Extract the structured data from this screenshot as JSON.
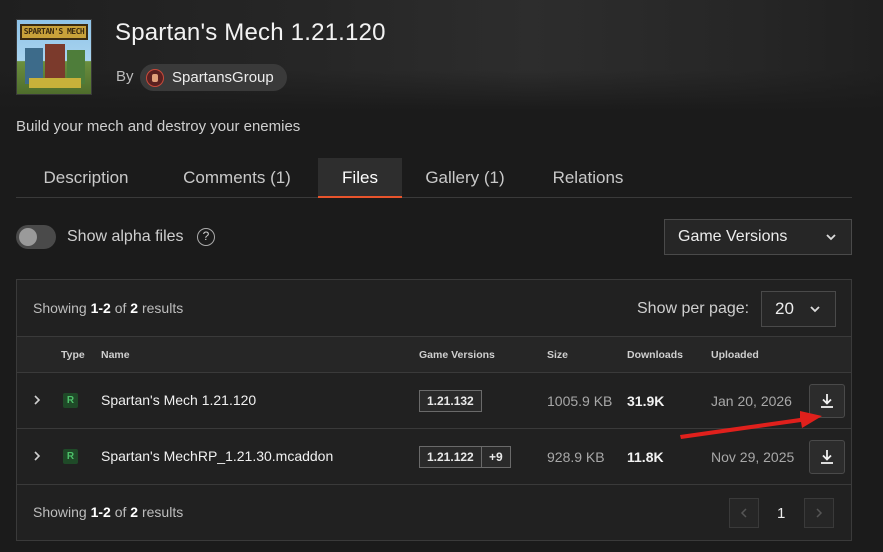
{
  "project": {
    "title": "Spartan's Mech 1.21.120",
    "by_label": "By",
    "author": "SpartansGroup",
    "summary": "Build your mech and destroy your enemies",
    "thumbnail_text": "SPARTAN'S MECH"
  },
  "tabs": [
    {
      "label": "Description"
    },
    {
      "label": "Comments (1)"
    },
    {
      "label": "Files",
      "active": true
    },
    {
      "label": "Gallery (1)"
    },
    {
      "label": "Relations"
    }
  ],
  "filters": {
    "alpha_label": "Show alpha files",
    "alpha_enabled": false,
    "help_glyph": "?",
    "game_versions_label": "Game Versions"
  },
  "results": {
    "showing_prefix": "Showing",
    "range": "1-2",
    "of": "of",
    "total": "2",
    "suffix": "results",
    "per_page_label": "Show per page:",
    "per_page_value": "20"
  },
  "table": {
    "headers": {
      "type": "Type",
      "name": "Name",
      "game_versions": "Game Versions",
      "size": "Size",
      "downloads": "Downloads",
      "uploaded": "Uploaded"
    },
    "rows": [
      {
        "type": "R",
        "name": "Spartan's Mech 1.21.120",
        "versions": [
          "1.21.132"
        ],
        "size": "1005.9 KB",
        "downloads": "31.9K",
        "uploaded": "Jan 20, 2026"
      },
      {
        "type": "R",
        "name": "Spartan's MechRP_1.21.30.mcaddon",
        "versions": [
          "1.21.122",
          "+9"
        ],
        "size": "928.9 KB",
        "downloads": "11.8K",
        "uploaded": "Nov 29, 2025"
      }
    ]
  },
  "pagination": {
    "current": "1"
  },
  "colors": {
    "accent": "#e8542c",
    "release_badge": "#4ec06a",
    "annotation_arrow": "#e0201c"
  },
  "icons": {
    "expand": "chevron-right-icon",
    "download": "download-icon",
    "dropdown": "chevron-down-icon",
    "annotation": "red-arrow-annotation"
  }
}
